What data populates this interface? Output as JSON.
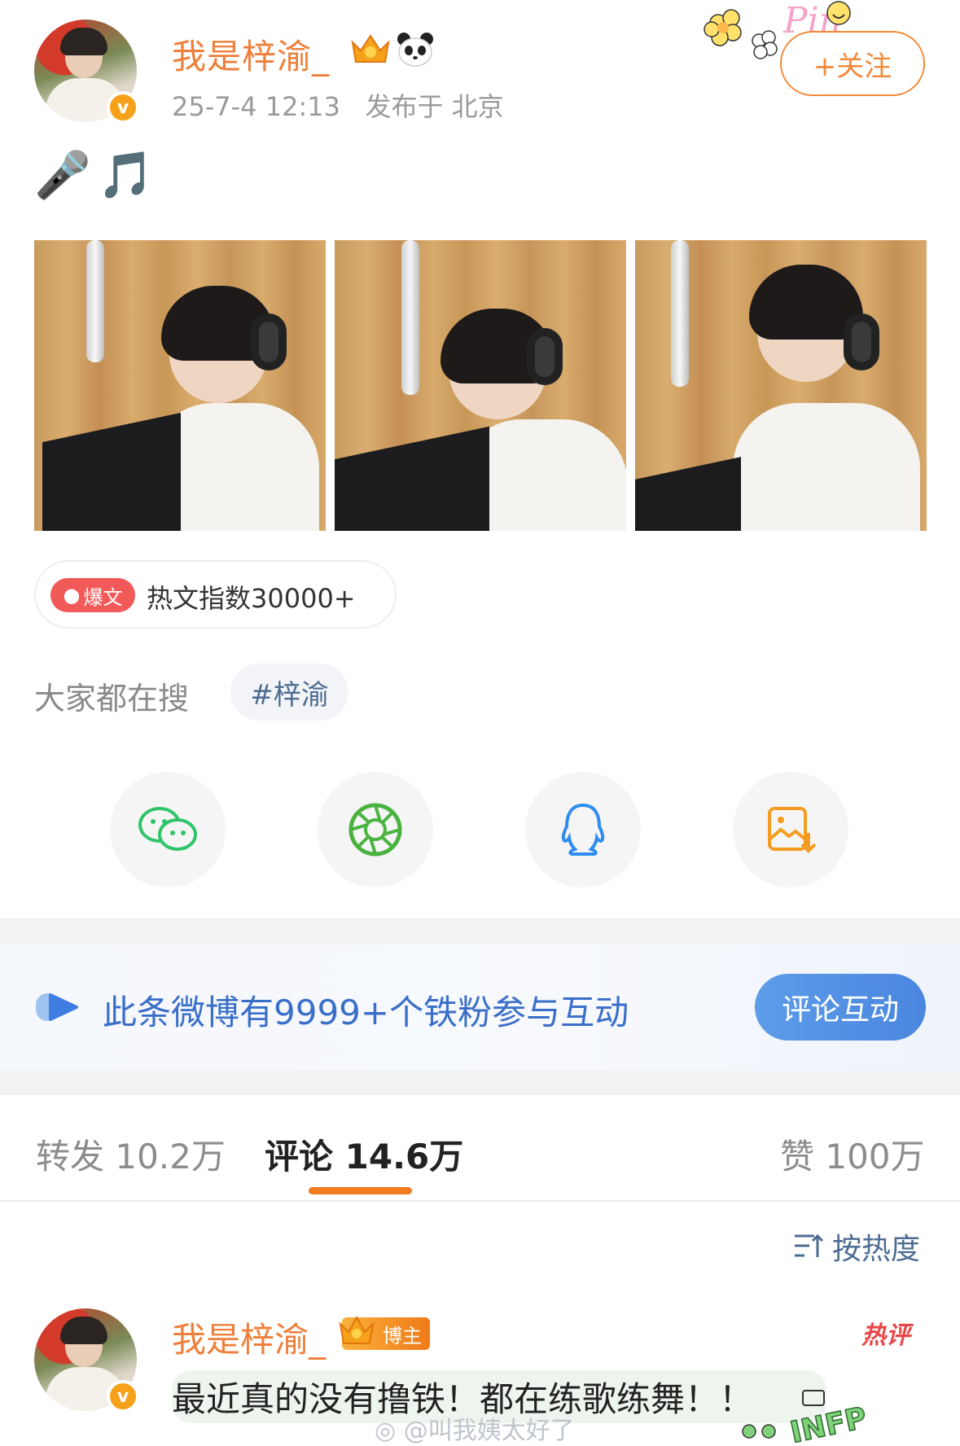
{
  "post": {
    "username": "我是梓渝_",
    "timestamp": "25-7-4 12:13",
    "location": "发布于 北京",
    "follow_label": "+关注",
    "content": "🎤🎵",
    "hot_tag": "爆文",
    "hot_index": "热文指数30000+",
    "search_label": "大家都在搜",
    "search_chip": "#梓渝"
  },
  "share": [
    "wechat-icon",
    "moments-icon",
    "qq-icon",
    "save-image-icon"
  ],
  "banner": {
    "text": "此条微博有9999+个铁粉参与互动",
    "button": "评论互动",
    "accent": "#3a6fc9"
  },
  "tabs": {
    "repost": "转发 10.2万",
    "comments": "评论 14.6万",
    "likes": "赞 100万"
  },
  "sort_label": "按热度",
  "comment": {
    "username": "我是梓渝_",
    "badge": "博主",
    "hot_label": "热评",
    "text": "最近真的没有撸铁！都在练歌练舞！！"
  },
  "watermark": "@叫我姨太好了",
  "colors": {
    "username": "#ef7f3a",
    "follow": "#f28a3b",
    "tab_underline": "#f27b20",
    "link_blue": "#4d6c92"
  }
}
